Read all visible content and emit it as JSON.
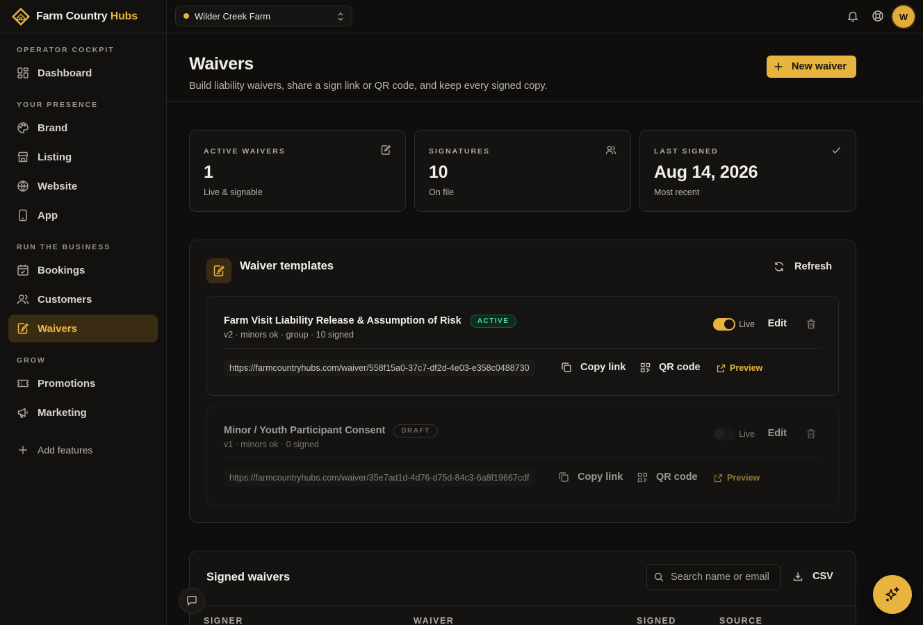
{
  "brand": {
    "name_main": "Farm Country",
    "name_accent": "Hubs"
  },
  "topbar": {
    "farm_name": "Wilder Creek Farm",
    "avatar_initial": "W"
  },
  "sidebar": {
    "sections": [
      "OPERATOR COCKPIT",
      "YOUR PRESENCE",
      "RUN THE BUSINESS",
      "GROW"
    ],
    "items": [
      {
        "label": "Dashboard",
        "icon": "dashboard-icon"
      },
      {
        "label": "Brand",
        "icon": "palette-icon"
      },
      {
        "label": "Listing",
        "icon": "store-icon"
      },
      {
        "label": "Website",
        "icon": "globe-icon"
      },
      {
        "label": "App",
        "icon": "phone-icon"
      },
      {
        "label": "Bookings",
        "icon": "calendar-icon"
      },
      {
        "label": "Customers",
        "icon": "users-icon"
      },
      {
        "label": "Waivers",
        "icon": "waiver-icon",
        "active": true
      },
      {
        "label": "Promotions",
        "icon": "ticket-icon"
      },
      {
        "label": "Marketing",
        "icon": "megaphone-icon"
      }
    ],
    "add_features": "Add features"
  },
  "header": {
    "title": "Waivers",
    "subtitle": "Build liability waivers, share a sign link or QR code, and keep every signed copy.",
    "new_button": "New waiver"
  },
  "stats": [
    {
      "label": "ACTIVE WAIVERS",
      "value": "1",
      "sub": "Live & signable",
      "icon": "edit-icon"
    },
    {
      "label": "SIGNATURES",
      "value": "10",
      "sub": "On file",
      "icon": "users-icon"
    },
    {
      "label": "LAST SIGNED",
      "value": "Aug 14, 2026",
      "sub": "Most recent",
      "icon": "check-icon"
    }
  ],
  "templates": {
    "title": "Waiver templates",
    "refresh": "Refresh",
    "live_label": "Live",
    "edit_label": "Edit",
    "copy_label": "Copy link",
    "qr_label": "QR code",
    "preview_label": "Preview",
    "items": [
      {
        "name": "Farm Visit Liability Release & Assumption of Risk",
        "status": "ACTIVE",
        "meta": "v2 · minors ok · group · 10 signed",
        "live": true,
        "url": "https://farmcountryhubs.com/waiver/558f15a0-37c7-df2d-4e03-e358c0488730"
      },
      {
        "name": "Minor / Youth Participant Consent",
        "status": "DRAFT",
        "meta": "v1 · minors ok · 0 signed",
        "live": false,
        "url": "https://farmcountryhubs.com/waiver/35e7ad1d-4d76-d75d-84c3-6a8f19667cdf"
      }
    ]
  },
  "signed": {
    "title": "Signed waivers",
    "search_placeholder": "Search name or email",
    "csv_label": "CSV",
    "columns": [
      "SIGNER",
      "WAIVER",
      "SIGNED",
      "SOURCE"
    ]
  },
  "colors": {
    "accent": "#e7b43f",
    "active_green": "#4fd89a",
    "background": "#0f0e0d"
  }
}
